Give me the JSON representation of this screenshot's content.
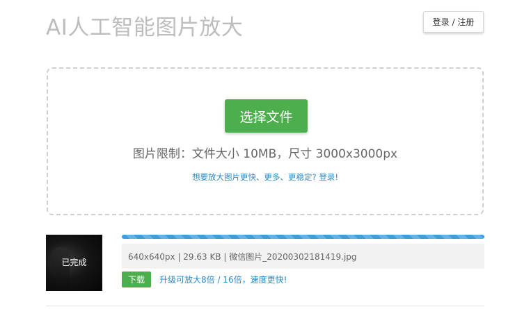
{
  "header": {
    "title": "AI人工智能图片放大",
    "login_label": "登录 / 注册"
  },
  "upload": {
    "select_button_label": "选择文件",
    "limit_text": "图片限制：文件大小 10MB，尺寸 3000x3000px",
    "upsell_link": "想要放大图片更快、更多、更稳定? 登录!"
  },
  "result": {
    "thumb_status": "已完成",
    "progress_fraction": 1.0,
    "file_info": "640x640px | 29.63 KB | 微信图片_20200302181419.jpg",
    "download_label": "下载",
    "upgrade_link": "升级可放大8倍 / 16倍，速度更快!"
  },
  "colors": {
    "accent_green": "#4cae4c",
    "link_blue": "#2a8bc5",
    "progress_blue": "#36a0e0"
  }
}
